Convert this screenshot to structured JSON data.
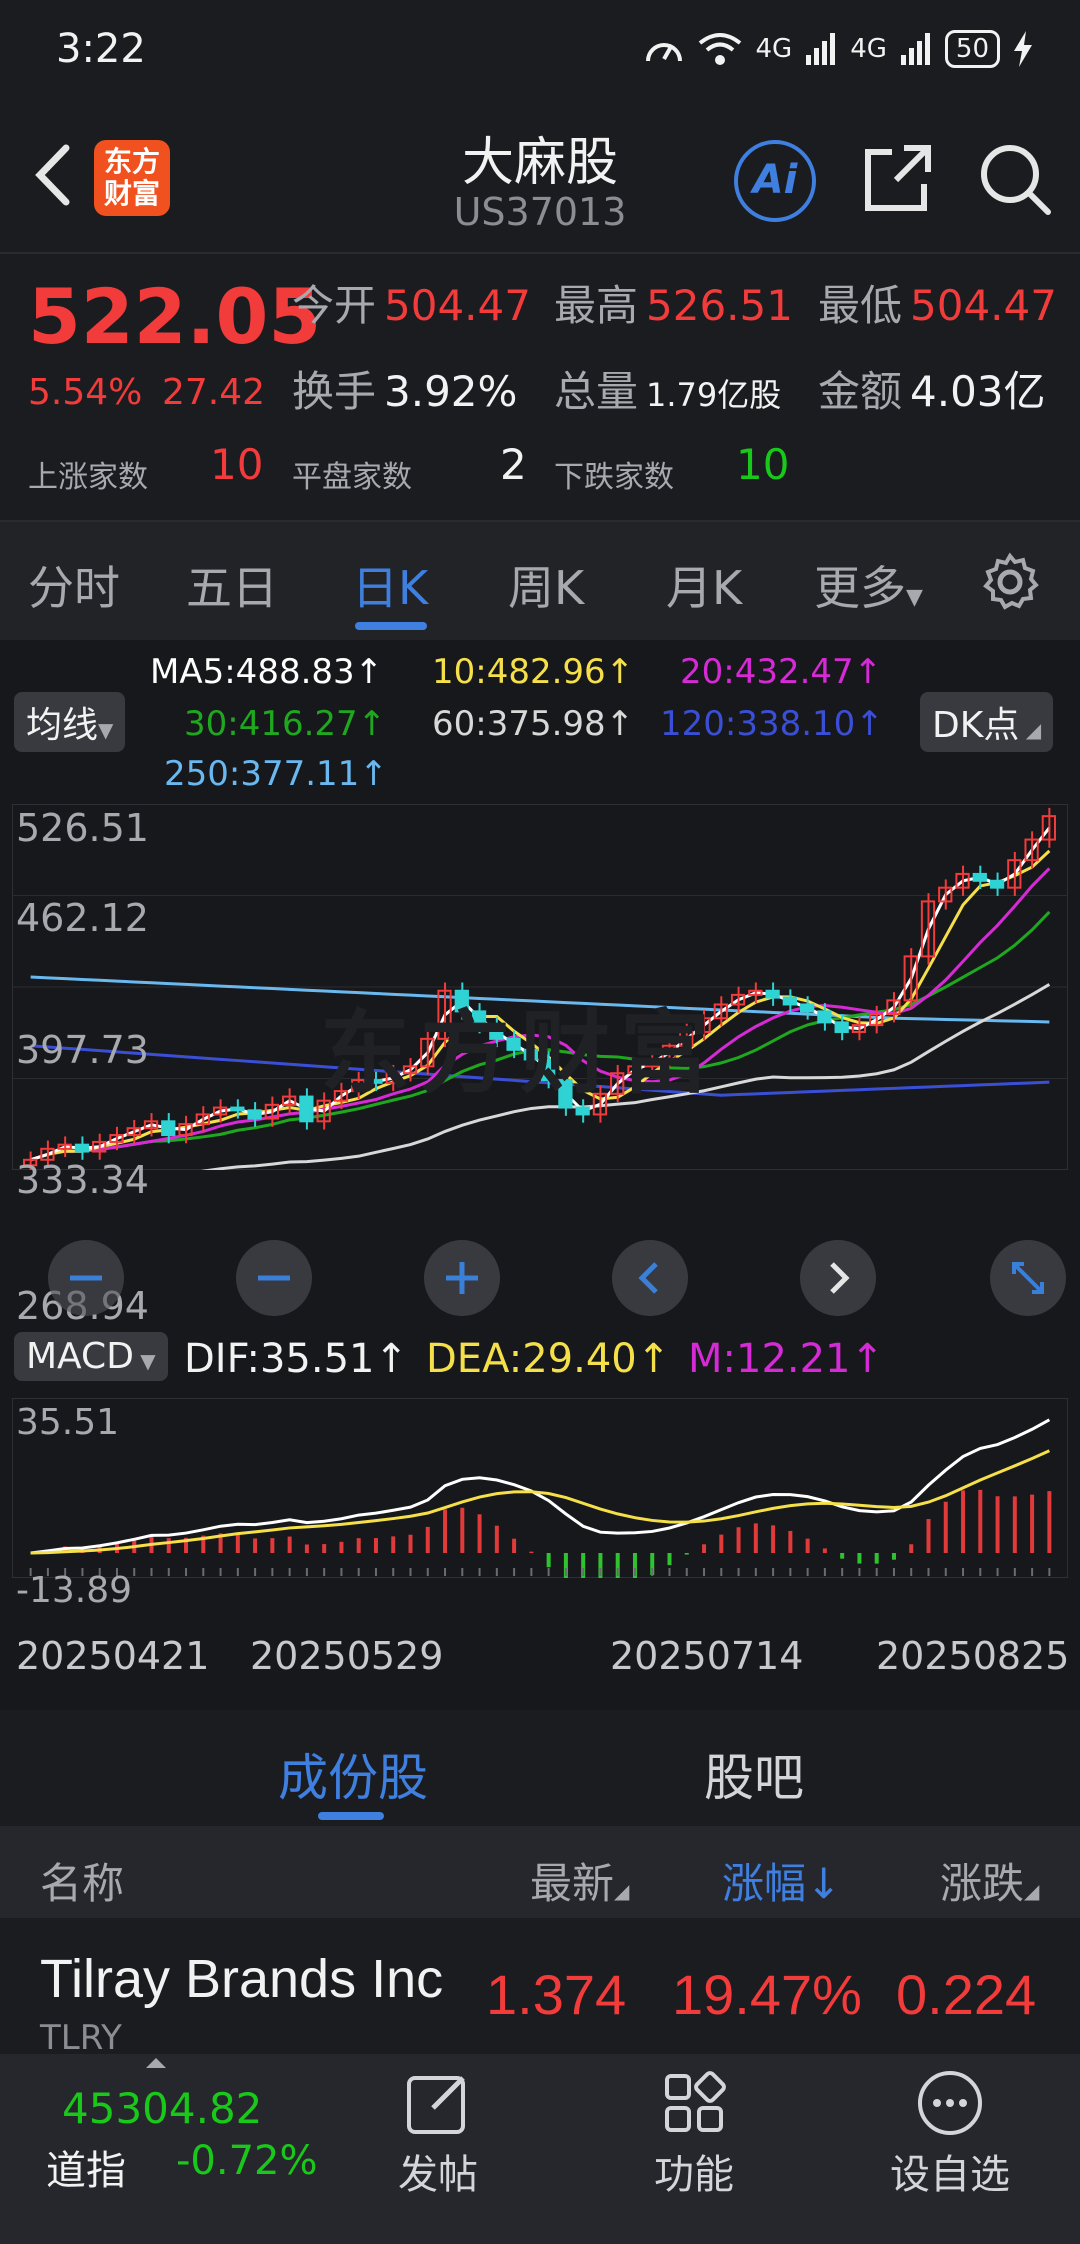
{
  "status": {
    "time": "3:22",
    "battery": "50",
    "net1": "4G",
    "net2": "4G"
  },
  "nav": {
    "logo_line1": "东方",
    "logo_line2": "财富",
    "title": "大麻股",
    "code": "US37013",
    "ai": "Ai"
  },
  "quote": {
    "price": "522.05",
    "change_pct": "5.54%",
    "change_val": "27.42",
    "open_label": "今开",
    "open": "504.47",
    "high_label": "最高",
    "high": "526.51",
    "low_label": "最低",
    "low": "504.47",
    "turnover_label": "换手",
    "turnover": "3.92%",
    "volume_label": "总量",
    "volume": "1.79亿股",
    "amount_label": "金额",
    "amount": "4.03亿",
    "up_label": "上涨家数",
    "up": "10",
    "flat_label": "平盘家数",
    "flat": "2",
    "down_label": "下跌家数",
    "down": "10"
  },
  "tabs": [
    "分时",
    "五日",
    "日K",
    "周K",
    "月K",
    "更多"
  ],
  "ma": {
    "ma5": "MA5:488.83↑",
    "ma10": "10:482.96↑",
    "ma20": "20:432.47↑",
    "ma30": "30:416.27↑",
    "ma60": "60:375.98↑",
    "ma120": "120:338.10↑",
    "ma250": "250:377.11↑",
    "btn_ma": "均线",
    "btn_dk": "DK点"
  },
  "colors": {
    "up": "#f23b3b",
    "down": "#2fd3d3",
    "ma5": "#ffffff",
    "ma10": "#f5e04a",
    "ma20": "#d62ad6",
    "ma30": "#1fa81f",
    "ma60": "#d8d8d8",
    "ma120": "#3a4fd6",
    "ma250": "#6ab8f0",
    "accent": "#3f7fe0"
  },
  "price_axis": [
    "526.51",
    "462.12",
    "397.73",
    "333.34",
    "268.94"
  ],
  "macd": {
    "btn": "MACD",
    "dif": "DIF:35.51↑",
    "dea": "DEA:29.40↑",
    "m": "M:12.21↑",
    "axis_top": "35.51",
    "axis_bottom": "-13.89"
  },
  "dates": [
    "20250421",
    "20250529",
    "20250714",
    "20250825"
  ],
  "watermark": "东方财富",
  "section_tabs": [
    "成份股",
    "股吧"
  ],
  "table": {
    "headers": [
      "名称",
      "最新",
      "涨幅↓",
      "涨跌"
    ],
    "rows": [
      {
        "name": "Tilray Brands Inc",
        "code": "TLRY",
        "last": "1.374",
        "pct": "19.47%",
        "chg": "0.224"
      }
    ]
  },
  "bottom": {
    "index_value": "45304.82",
    "index_name": "道指",
    "index_change": "-0.72%",
    "items": [
      "发帖",
      "功能",
      "设自选"
    ]
  },
  "chart_data": {
    "type": "candlestick",
    "ylim": [
      268.94,
      526.51
    ],
    "close_series_approx": [
      272,
      280,
      283,
      278,
      285,
      290,
      295,
      300,
      290,
      298,
      305,
      310,
      308,
      302,
      312,
      318,
      300,
      315,
      322,
      330,
      328,
      335,
      340,
      360,
      395,
      380,
      370,
      360,
      352,
      345,
      330,
      310,
      305,
      320,
      335,
      340,
      345,
      355,
      365,
      375,
      385,
      392,
      395,
      390,
      385,
      380,
      372,
      365,
      370,
      378,
      388,
      420,
      460,
      470,
      480,
      475,
      470,
      490,
      505,
      522.05
    ]
  }
}
